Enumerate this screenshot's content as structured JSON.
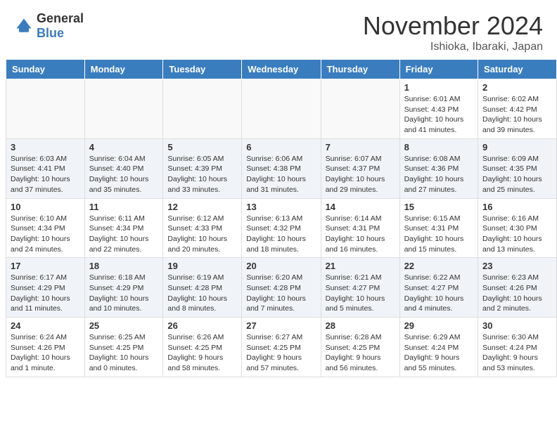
{
  "header": {
    "logo_general": "General",
    "logo_blue": "Blue",
    "month_title": "November 2024",
    "location": "Ishioka, Ibaraki, Japan"
  },
  "calendar": {
    "days_of_week": [
      "Sunday",
      "Monday",
      "Tuesday",
      "Wednesday",
      "Thursday",
      "Friday",
      "Saturday"
    ],
    "weeks": [
      [
        {
          "day": "",
          "info": ""
        },
        {
          "day": "",
          "info": ""
        },
        {
          "day": "",
          "info": ""
        },
        {
          "day": "",
          "info": ""
        },
        {
          "day": "",
          "info": ""
        },
        {
          "day": "1",
          "info": "Sunrise: 6:01 AM\nSunset: 4:43 PM\nDaylight: 10 hours\nand 41 minutes."
        },
        {
          "day": "2",
          "info": "Sunrise: 6:02 AM\nSunset: 4:42 PM\nDaylight: 10 hours\nand 39 minutes."
        }
      ],
      [
        {
          "day": "3",
          "info": "Sunrise: 6:03 AM\nSunset: 4:41 PM\nDaylight: 10 hours\nand 37 minutes."
        },
        {
          "day": "4",
          "info": "Sunrise: 6:04 AM\nSunset: 4:40 PM\nDaylight: 10 hours\nand 35 minutes."
        },
        {
          "day": "5",
          "info": "Sunrise: 6:05 AM\nSunset: 4:39 PM\nDaylight: 10 hours\nand 33 minutes."
        },
        {
          "day": "6",
          "info": "Sunrise: 6:06 AM\nSunset: 4:38 PM\nDaylight: 10 hours\nand 31 minutes."
        },
        {
          "day": "7",
          "info": "Sunrise: 6:07 AM\nSunset: 4:37 PM\nDaylight: 10 hours\nand 29 minutes."
        },
        {
          "day": "8",
          "info": "Sunrise: 6:08 AM\nSunset: 4:36 PM\nDaylight: 10 hours\nand 27 minutes."
        },
        {
          "day": "9",
          "info": "Sunrise: 6:09 AM\nSunset: 4:35 PM\nDaylight: 10 hours\nand 25 minutes."
        }
      ],
      [
        {
          "day": "10",
          "info": "Sunrise: 6:10 AM\nSunset: 4:34 PM\nDaylight: 10 hours\nand 24 minutes."
        },
        {
          "day": "11",
          "info": "Sunrise: 6:11 AM\nSunset: 4:34 PM\nDaylight: 10 hours\nand 22 minutes."
        },
        {
          "day": "12",
          "info": "Sunrise: 6:12 AM\nSunset: 4:33 PM\nDaylight: 10 hours\nand 20 minutes."
        },
        {
          "day": "13",
          "info": "Sunrise: 6:13 AM\nSunset: 4:32 PM\nDaylight: 10 hours\nand 18 minutes."
        },
        {
          "day": "14",
          "info": "Sunrise: 6:14 AM\nSunset: 4:31 PM\nDaylight: 10 hours\nand 16 minutes."
        },
        {
          "day": "15",
          "info": "Sunrise: 6:15 AM\nSunset: 4:31 PM\nDaylight: 10 hours\nand 15 minutes."
        },
        {
          "day": "16",
          "info": "Sunrise: 6:16 AM\nSunset: 4:30 PM\nDaylight: 10 hours\nand 13 minutes."
        }
      ],
      [
        {
          "day": "17",
          "info": "Sunrise: 6:17 AM\nSunset: 4:29 PM\nDaylight: 10 hours\nand 11 minutes."
        },
        {
          "day": "18",
          "info": "Sunrise: 6:18 AM\nSunset: 4:29 PM\nDaylight: 10 hours\nand 10 minutes."
        },
        {
          "day": "19",
          "info": "Sunrise: 6:19 AM\nSunset: 4:28 PM\nDaylight: 10 hours\nand 8 minutes."
        },
        {
          "day": "20",
          "info": "Sunrise: 6:20 AM\nSunset: 4:28 PM\nDaylight: 10 hours\nand 7 minutes."
        },
        {
          "day": "21",
          "info": "Sunrise: 6:21 AM\nSunset: 4:27 PM\nDaylight: 10 hours\nand 5 minutes."
        },
        {
          "day": "22",
          "info": "Sunrise: 6:22 AM\nSunset: 4:27 PM\nDaylight: 10 hours\nand 4 minutes."
        },
        {
          "day": "23",
          "info": "Sunrise: 6:23 AM\nSunset: 4:26 PM\nDaylight: 10 hours\nand 2 minutes."
        }
      ],
      [
        {
          "day": "24",
          "info": "Sunrise: 6:24 AM\nSunset: 4:26 PM\nDaylight: 10 hours\nand 1 minute."
        },
        {
          "day": "25",
          "info": "Sunrise: 6:25 AM\nSunset: 4:25 PM\nDaylight: 10 hours\nand 0 minutes."
        },
        {
          "day": "26",
          "info": "Sunrise: 6:26 AM\nSunset: 4:25 PM\nDaylight: 9 hours\nand 58 minutes."
        },
        {
          "day": "27",
          "info": "Sunrise: 6:27 AM\nSunset: 4:25 PM\nDaylight: 9 hours\nand 57 minutes."
        },
        {
          "day": "28",
          "info": "Sunrise: 6:28 AM\nSunset: 4:25 PM\nDaylight: 9 hours\nand 56 minutes."
        },
        {
          "day": "29",
          "info": "Sunrise: 6:29 AM\nSunset: 4:24 PM\nDaylight: 9 hours\nand 55 minutes."
        },
        {
          "day": "30",
          "info": "Sunrise: 6:30 AM\nSunset: 4:24 PM\nDaylight: 9 hours\nand 53 minutes."
        }
      ]
    ]
  }
}
